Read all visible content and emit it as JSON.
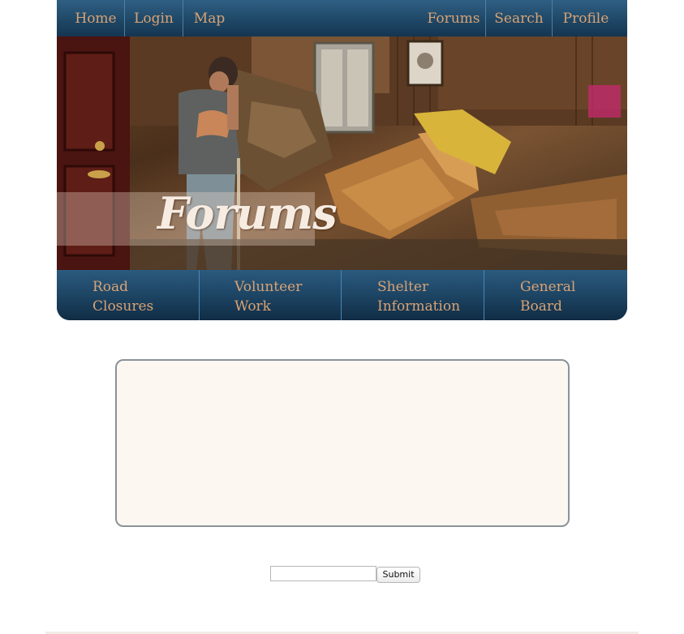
{
  "top_nav": {
    "left": [
      "Home",
      "Login",
      "Map"
    ],
    "right": [
      "Forums",
      "Search",
      "Profile"
    ]
  },
  "hero": {
    "title": "Forums"
  },
  "sub_nav": [
    {
      "line1": "Road",
      "line2": "Closures"
    },
    {
      "line1": "Volunteer",
      "line2": "Work"
    },
    {
      "line1": "Shelter",
      "line2": "Information"
    },
    {
      "line1": "General",
      "line2": "Board"
    }
  ],
  "form": {
    "input_value": "",
    "submit_label": "Submit"
  },
  "colors": {
    "nav_text": "#d9a274",
    "nav_background": "#1f4866",
    "content_background": "#fcf7f1"
  }
}
